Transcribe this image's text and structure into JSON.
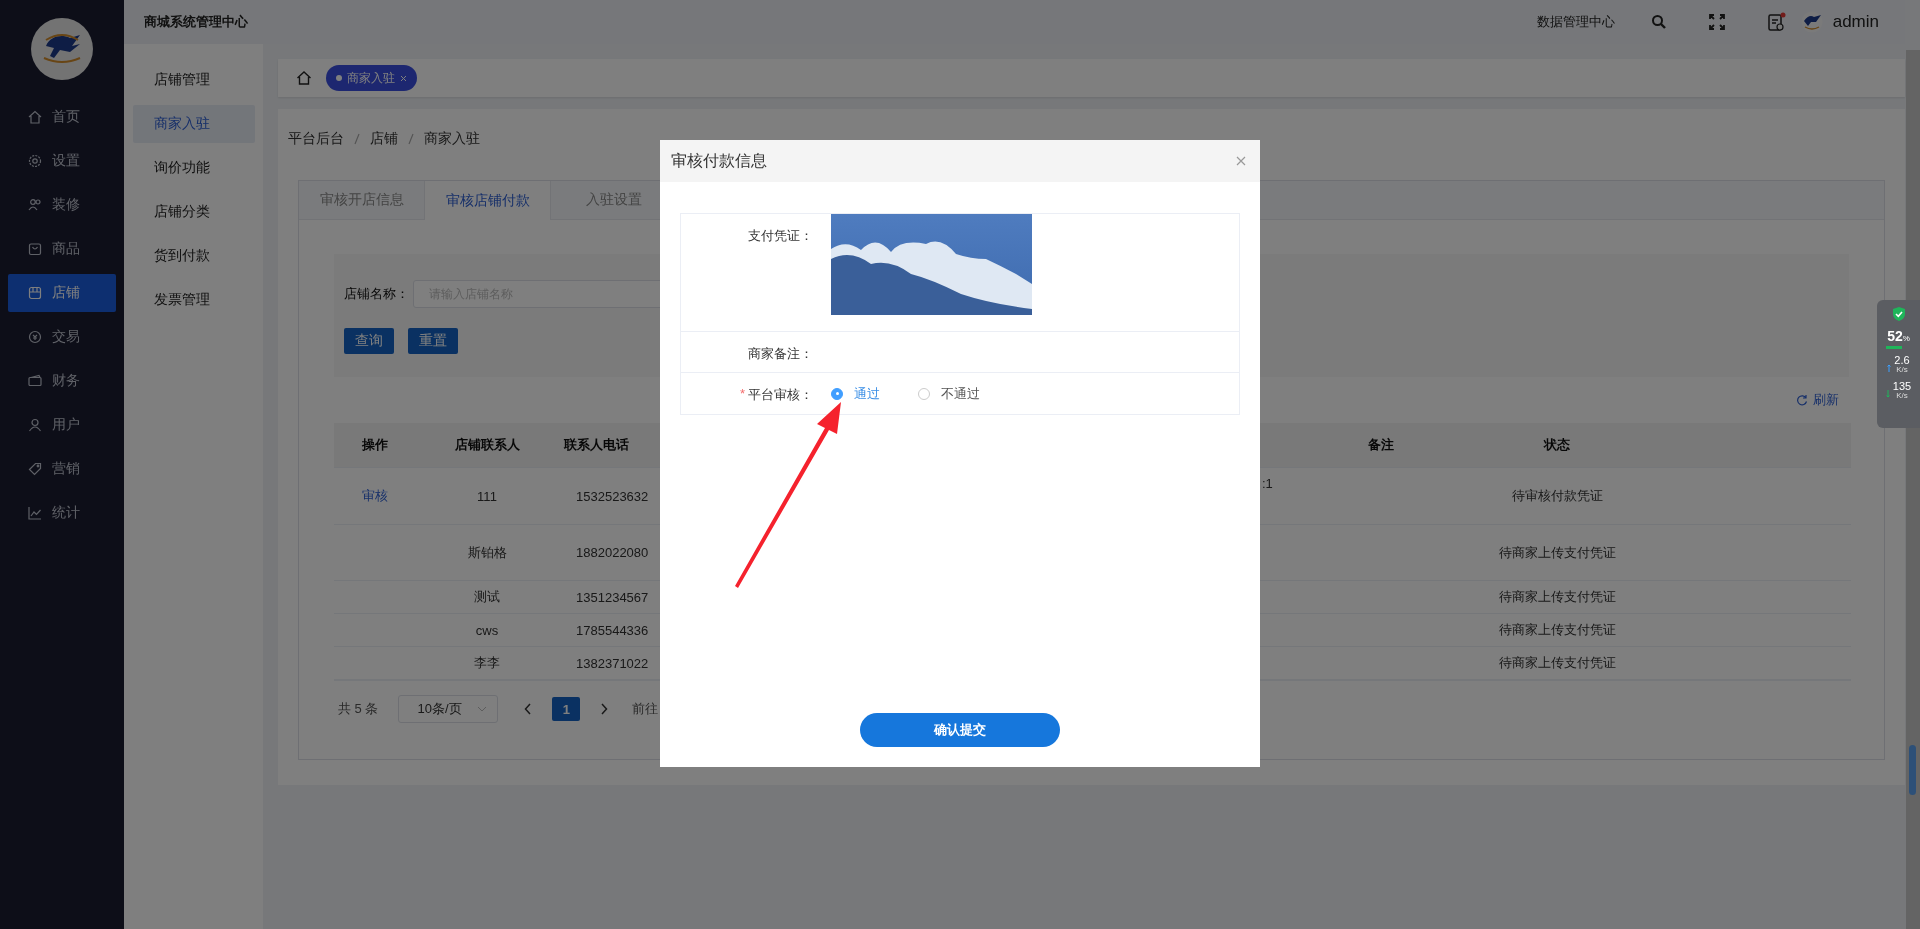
{
  "header": {
    "title": "商城系统管理中心",
    "data_center": "数据管理中心",
    "user": "admin"
  },
  "sidebar": {
    "items": [
      {
        "label": "首页",
        "kind": "home",
        "selected": false
      },
      {
        "label": "设置",
        "kind": "gear",
        "selected": false
      },
      {
        "label": "装修",
        "kind": "people",
        "selected": false
      },
      {
        "label": "商品",
        "kind": "bag",
        "selected": false
      },
      {
        "label": "店铺",
        "kind": "store",
        "selected": true
      },
      {
        "label": "交易",
        "kind": "coin",
        "selected": false
      },
      {
        "label": "财务",
        "kind": "wallet",
        "selected": false
      },
      {
        "label": "用户",
        "kind": "user",
        "selected": false
      },
      {
        "label": "营销",
        "kind": "tag",
        "selected": false
      },
      {
        "label": "统计",
        "kind": "chart",
        "selected": false
      }
    ]
  },
  "submenu": {
    "items": [
      {
        "label": "店铺管理",
        "selected": false
      },
      {
        "label": "商家入驻",
        "selected": true
      },
      {
        "label": "询价功能",
        "selected": false
      },
      {
        "label": "店铺分类",
        "selected": false
      },
      {
        "label": "货到付款",
        "selected": false
      },
      {
        "label": "发票管理",
        "selected": false
      }
    ]
  },
  "tags": [
    {
      "label": "商家入驻",
      "selected": true
    }
  ],
  "breadcrumb": [
    "平台后台",
    "店铺",
    "商家入驻"
  ],
  "tabs": [
    {
      "label": "审核开店信息",
      "selected": false
    },
    {
      "label": "审核店铺付款",
      "selected": true
    },
    {
      "label": "入驻设置",
      "selected": false
    }
  ],
  "filter": {
    "label": "店铺名称：",
    "placeholder": "请输入店铺名称",
    "buttons": [
      "查询",
      "重置"
    ]
  },
  "refresh": "刷新",
  "table": {
    "columns": {
      "action": "操作",
      "contact": "店铺联系人",
      "phone": "联系人电话",
      "note": "备注",
      "status": "状态"
    },
    "rows": [
      {
        "action": "审核",
        "contact": "111",
        "phone": "1532523632",
        "column_4": ":1",
        "status": "待审核付款凭证"
      },
      {
        "contact": "斯铂格",
        "phone": "1882022080",
        "status": "待商家上传支付凭证"
      },
      {
        "contact": "测试",
        "phone": "1351234567",
        "status": "待商家上传支付凭证"
      },
      {
        "contact": "cws",
        "phone": "1785544336",
        "status": "待商家上传支付凭证"
      },
      {
        "contact": "李李",
        "phone": "1382371022",
        "status": "待商家上传支付凭证"
      }
    ]
  },
  "pagination": {
    "total": "共 5 条",
    "page_size": "10条/页",
    "pages": [
      {
        "label": "1",
        "selected": true
      }
    ],
    "goto": "前往"
  },
  "modal": {
    "title": "审核付款信息",
    "fields": [
      {
        "kind": "image",
        "label": "支付凭证："
      },
      {
        "kind": "text",
        "label": "商家备注："
      },
      {
        "kind": "radio",
        "required_mark": "*",
        "label": "平台审核：",
        "options": [
          {
            "label": "通过",
            "selected": true
          },
          {
            "label": "不通过",
            "selected": false
          }
        ]
      }
    ],
    "submit": "确认提交"
  },
  "monitor": {
    "percent": "52",
    "percent_unit": "%",
    "upload": "2.6",
    "upload_unit": "K/s",
    "download": "135",
    "download_unit": "K/s"
  }
}
